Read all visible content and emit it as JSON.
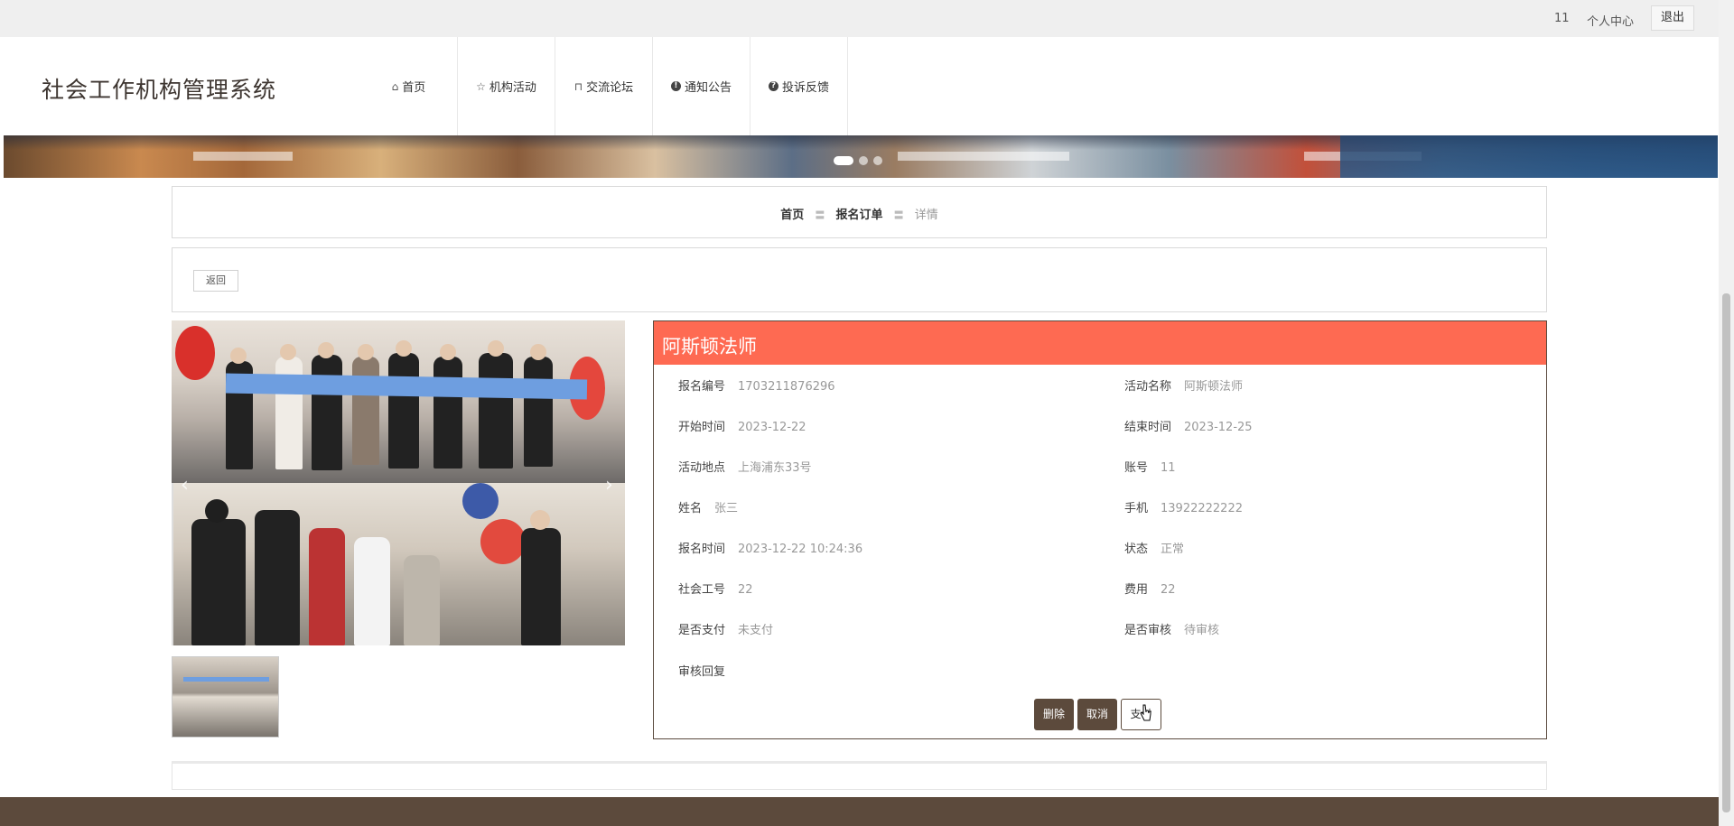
{
  "topbar": {
    "user": "11",
    "center_label": "个人中心",
    "logout_label": "退出"
  },
  "header": {
    "brand": "社会工作机构管理系统",
    "nav": [
      {
        "label": "首页",
        "icon": "home-icon"
      },
      {
        "label": "机构活动",
        "icon": "star-icon"
      },
      {
        "label": "交流论坛",
        "icon": "bag-icon"
      },
      {
        "label": "通知公告",
        "icon": "alert-icon"
      },
      {
        "label": "投诉反馈",
        "icon": "question-icon"
      }
    ]
  },
  "banner": {
    "slides": 3,
    "active_slide": 1
  },
  "breadcrumb": {
    "home": "首页",
    "section": "报名订单",
    "current": "详情",
    "separator": "〓"
  },
  "back_label": "返回",
  "detail": {
    "title": "阿斯顿法师",
    "fields": {
      "order_no": {
        "label": "报名编号",
        "value": "1703211876296"
      },
      "activity_name": {
        "label": "活动名称",
        "value": "阿斯顿法师"
      },
      "start_time": {
        "label": "开始时间",
        "value": "2023-12-22"
      },
      "end_time": {
        "label": "结束时间",
        "value": "2023-12-25"
      },
      "location": {
        "label": "活动地点",
        "value": "上海浦东33号"
      },
      "account": {
        "label": "账号",
        "value": "11"
      },
      "name": {
        "label": "姓名",
        "value": "张三"
      },
      "phone": {
        "label": "手机",
        "value": "13922222222"
      },
      "signup_time": {
        "label": "报名时间",
        "value": "2023-12-22 10:24:36"
      },
      "status": {
        "label": "状态",
        "value": "正常"
      },
      "worker_no": {
        "label": "社会工号",
        "value": "22"
      },
      "fee": {
        "label": "费用",
        "value": "22"
      },
      "paid": {
        "label": "是否支付",
        "value": "未支付"
      },
      "reviewed": {
        "label": "是否审核",
        "value": "待审核"
      },
      "review_reply": {
        "label": "审核回复",
        "value": ""
      }
    },
    "actions": {
      "delete": "删除",
      "cancel": "取消",
      "pay": "支付"
    }
  },
  "colors": {
    "accent": "#fe6a52",
    "brand_dark": "#5c4a3c"
  }
}
